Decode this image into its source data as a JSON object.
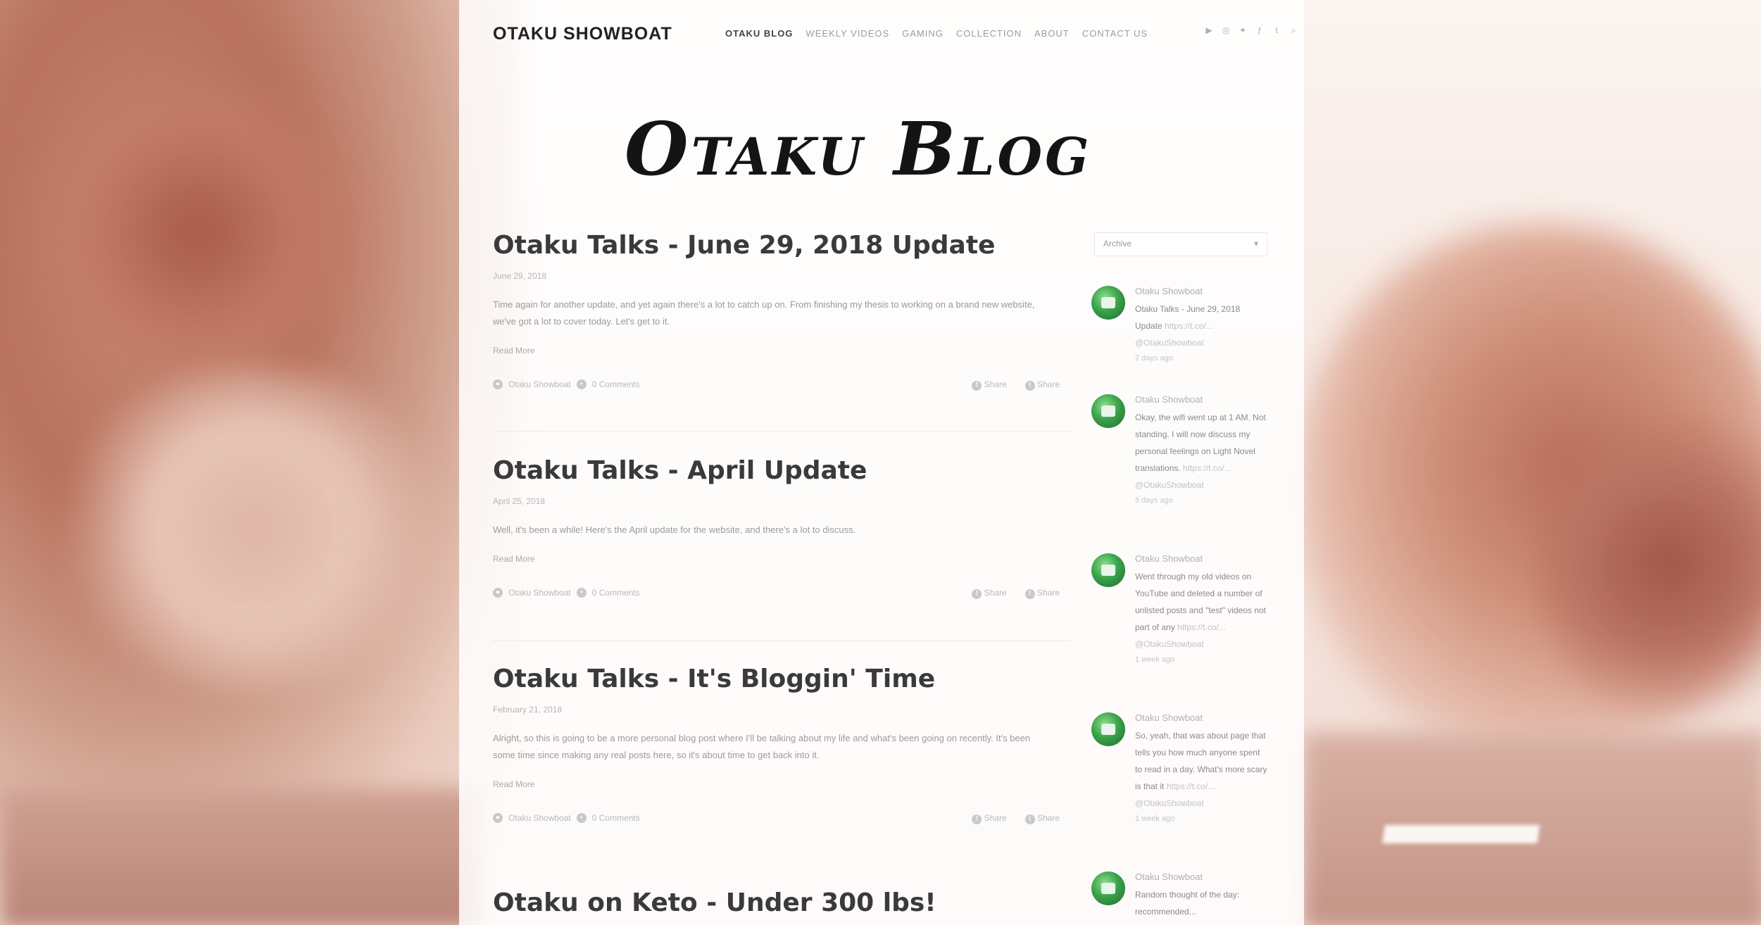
{
  "site": {
    "brand": "OTAKU SHOWBOAT",
    "nav": [
      "OTAKU BLOG",
      "WEEKLY VIDEOS",
      "GAMING",
      "COLLECTION",
      "ABOUT",
      "CONTACT US"
    ],
    "social_icons": [
      "youtube-icon",
      "instagram-icon",
      "twitter-icon",
      "facebook-icon",
      "tumblr-icon",
      "search-icon"
    ]
  },
  "blog_title": "Otaku Blog",
  "posts": [
    {
      "title": "Otaku Talks - June 29, 2018 Update",
      "date": "June 29, 2018",
      "excerpt": "Time again for another update, and yet again there's a lot to catch up on. From finishing my thesis to working on a brand new website, we've got a lot to cover today. Let's get to it.",
      "read_more": "Read More",
      "author": "Otaku Showboat",
      "comments": "0 Comments",
      "share_1": "Share",
      "share_2": "Share"
    },
    {
      "title": "Otaku Talks - April Update",
      "date": "April 25, 2018",
      "excerpt": "Well, it's been a while! Here's the April update for the website, and there's a lot to discuss.",
      "read_more": "Read More",
      "author": "Otaku Showboat",
      "comments": "0 Comments",
      "share_1": "Share",
      "share_2": "Share"
    },
    {
      "title": "Otaku Talks - It's Bloggin' Time",
      "date": "February 21, 2018",
      "excerpt": "Alright, so this is going to be a more personal blog post where I'll be talking about my life and what's been going on recently. It's been some time since making any real posts here, so it's about time to get back into it.",
      "read_more": "Read More",
      "author": "Otaku Showboat",
      "comments": "0 Comments",
      "share_1": "Share",
      "share_2": "Share"
    },
    {
      "title": "Otaku on Keto - Under 300 lbs!"
    }
  ],
  "sidebar": {
    "archive_label": "Archive",
    "tweets": [
      {
        "author": "Otaku Showboat",
        "text": "Otaku Talks - June 29, 2018 Update",
        "link": "https://t.co/...",
        "handle": "@OtakuShowboat",
        "time": "2 days ago"
      },
      {
        "author": "Otaku Showboat",
        "text": "Okay, the wifi went up at 1 AM. Not standing. I will now discuss my personal feelings on Light Novel translations.",
        "link": "https://t.co/...",
        "handle": "@OtakuShowboat",
        "time": "5 days ago"
      },
      {
        "author": "Otaku Showboat",
        "text": "Went through my old videos on YouTube and deleted a number of unlisted posts and \"test\" videos not part of any",
        "link": "https://t.co/...",
        "handle": "@OtakuShowboat",
        "time": "1 week ago"
      },
      {
        "author": "Otaku Showboat",
        "text": "So, yeah, that was about page that tells you how much anyone spent to read in a day. What's more scary is that it",
        "link": "https://t.co/...",
        "handle": "@OtakuShowboat",
        "time": "1 week ago"
      },
      {
        "author": "Otaku Showboat",
        "text": "Random thought of the day: recommended...",
        "link": "",
        "handle": "",
        "time": ""
      }
    ]
  }
}
